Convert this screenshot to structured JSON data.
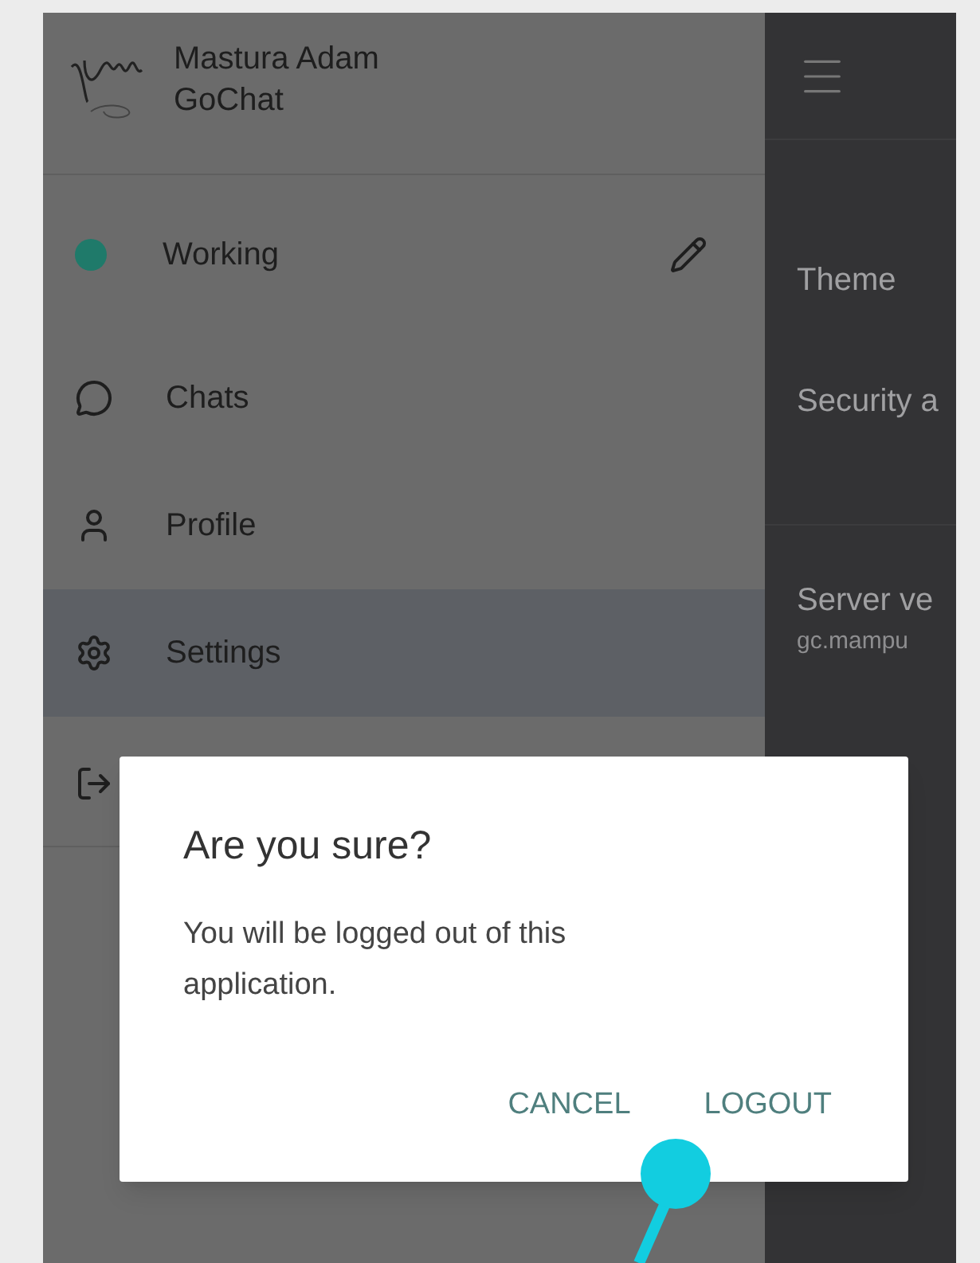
{
  "drawer": {
    "user_name": "Mastura Adam",
    "app_name": "GoChat",
    "status": {
      "label": "Working",
      "color": "#1f7a6a"
    },
    "items": [
      {
        "kind": "chats",
        "label": "Chats",
        "selected": false
      },
      {
        "kind": "profile",
        "label": "Profile",
        "selected": false
      },
      {
        "kind": "settings",
        "label": "Settings",
        "selected": true
      },
      {
        "kind": "logout",
        "selected": false
      }
    ]
  },
  "settings_panel": {
    "items": [
      {
        "kind": "row",
        "label": "Theme"
      },
      {
        "kind": "row",
        "label": "Security a"
      },
      {
        "kind": "divider"
      },
      {
        "kind": "row",
        "label": "Server ve",
        "sublabel": "gc.mampu"
      }
    ]
  },
  "dialog": {
    "title": "Are you sure?",
    "message": "You will be logged out of this application.",
    "buttons": [
      "CANCEL",
      "LOGOUT"
    ]
  }
}
